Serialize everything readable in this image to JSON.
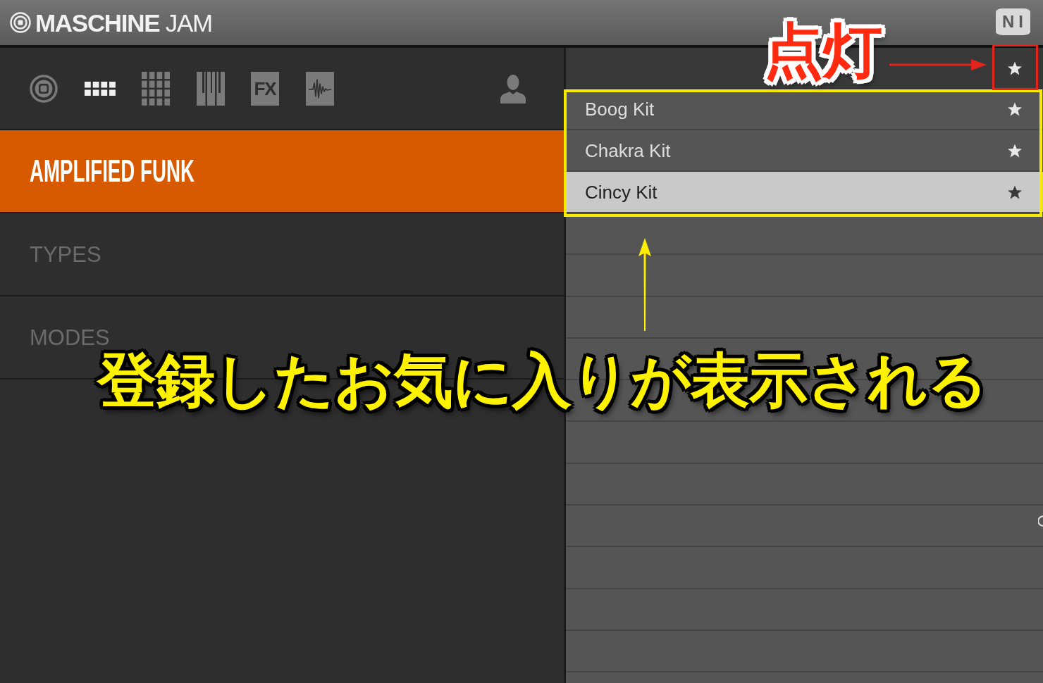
{
  "title_bar": {
    "title": "**MASCHINE** JAM",
    "logo_mark": "NI"
  },
  "toolbar": [
    {
      "kind": "ring",
      "selected": false
    },
    {
      "kind": "dots",
      "selected": true
    },
    {
      "kind": "grid",
      "selected": false
    },
    {
      "kind": "keys",
      "selected": false
    },
    {
      "kind": "fx",
      "label": "FX",
      "selected": false
    },
    {
      "kind": "wave",
      "selected": false
    }
  ],
  "sidebar": {
    "items": [
      {
        "label": "AMPLIFIED FUNK",
        "selected": true
      },
      {
        "label": "TYPES",
        "selected": false
      },
      {
        "label": "MODES",
        "selected": false
      }
    ]
  },
  "favorites": {
    "filter_on": true,
    "items": [
      {
        "name": "Boog Kit",
        "favorite": true,
        "selected": false
      },
      {
        "name": "Chakra Kit",
        "favorite": true,
        "selected": false
      },
      {
        "name": "Cincy Kit",
        "favorite": true,
        "selected": true
      }
    ]
  },
  "annotations": {
    "label": "点灯",
    "caption": "登録したお気に入りが表示される"
  }
}
